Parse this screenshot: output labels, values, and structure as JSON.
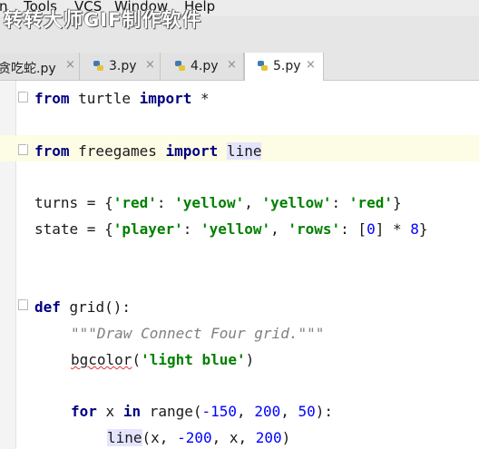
{
  "menu": {
    "items": [
      "n",
      "Tools",
      "VCS",
      "Window",
      "Help"
    ]
  },
  "watermark": "转转大师GIF制作软件",
  "tabs": [
    {
      "label": "贪吃蛇.py",
      "active": false
    },
    {
      "label": "3.py",
      "active": false
    },
    {
      "label": "4.py",
      "active": false
    },
    {
      "label": "5.py",
      "active": true
    }
  ],
  "close_glyph": "×",
  "code": {
    "l1": {
      "kw1": "from",
      "mod": " turtle ",
      "kw2": "import",
      "rest": " *"
    },
    "l2": {
      "kw1": "from",
      "mod": " freegames ",
      "kw2": "import",
      "sp": " ",
      "name": "line"
    },
    "l3": {
      "a": "turns = {",
      "s1": "'red'",
      "b": ": ",
      "s2": "'yellow'",
      "c": ", ",
      "s3": "'yellow'",
      "d": ": ",
      "s4": "'red'",
      "e": "}"
    },
    "l4": {
      "a": "state = {",
      "s1": "'player'",
      "b": ": ",
      "s2": "'yellow'",
      "c": ", ",
      "s3": "'rows'",
      "d": ": [",
      "n1": "0",
      "e": "] * ",
      "n2": "8",
      "f": "}"
    },
    "l5": {
      "kw": "def",
      "rest": " grid():"
    },
    "l6": {
      "doc": "\"\"\"Draw Connect Four grid.\"\"\""
    },
    "l7": {
      "fn": "bgcolor",
      "a": "(",
      "s": "'light blue'",
      "b": ")"
    },
    "l8": {
      "kw1": "for",
      "a": " x ",
      "kw2": "in",
      "b": " range(",
      "n1": "-150",
      "c": ", ",
      "n2": "200",
      "d": ", ",
      "n3": "50",
      "e": "):"
    },
    "l9": {
      "fn": "line",
      "a": "(x, ",
      "n1": "-200",
      "b": ", x, ",
      "n2": "200",
      "c": ")"
    }
  }
}
